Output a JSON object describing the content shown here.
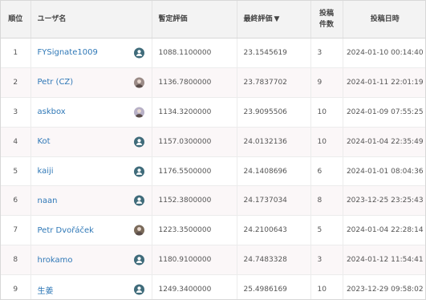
{
  "table": {
    "headers": {
      "rank": "順位",
      "user": "ユーザ名",
      "provisional": "暫定評価",
      "final": "最終評価",
      "final_sort_icon": "▼",
      "posts_line1": "投稿",
      "posts_line2": "件数",
      "post_time": "投稿日時"
    },
    "rows": [
      {
        "rank": "1",
        "user": "FYSignate1009",
        "avatar": "user-icon",
        "provisional": "1088.1100000",
        "final": "23.1545619",
        "posts": "3",
        "time": "2024-01-10 00:14:40"
      },
      {
        "rank": "2",
        "user": "Petr (CZ)",
        "avatar": "photo-avatar",
        "provisional": "1136.7800000",
        "final": "23.7837702",
        "posts": "9",
        "time": "2024-01-11 22:01:19"
      },
      {
        "rank": "3",
        "user": "askbox",
        "avatar": "photo-avatar",
        "provisional": "1134.3200000",
        "final": "23.9095506",
        "posts": "10",
        "time": "2024-01-09 07:55:25"
      },
      {
        "rank": "4",
        "user": "Kot",
        "avatar": "user-icon",
        "provisional": "1157.0300000",
        "final": "24.0132136",
        "posts": "10",
        "time": "2024-01-04 22:35:49"
      },
      {
        "rank": "5",
        "user": "kaiji",
        "avatar": "user-icon",
        "provisional": "1176.5500000",
        "final": "24.1408696",
        "posts": "6",
        "time": "2024-01-01 08:04:36"
      },
      {
        "rank": "6",
        "user": "naan",
        "avatar": "user-icon",
        "provisional": "1152.3800000",
        "final": "24.1737034",
        "posts": "8",
        "time": "2023-12-25 23:25:43"
      },
      {
        "rank": "7",
        "user": "Petr Dvořáček",
        "avatar": "photo-avatar",
        "provisional": "1223.3500000",
        "final": "24.2100643",
        "posts": "5",
        "time": "2024-01-04 22:28:14"
      },
      {
        "rank": "8",
        "user": "hrokamo",
        "avatar": "user-icon",
        "provisional": "1180.9100000",
        "final": "24.7483328",
        "posts": "3",
        "time": "2024-01-12 11:54:41"
      },
      {
        "rank": "9",
        "user": "生姜",
        "avatar": "user-icon",
        "provisional": "1249.3400000",
        "final": "25.4986169",
        "posts": "10",
        "time": "2023-12-29 09:58:02"
      }
    ]
  },
  "colors": {
    "link": "#2f78b7",
    "header_bg": "#f3f3f3",
    "avatar_default": "#3f6b7a"
  }
}
